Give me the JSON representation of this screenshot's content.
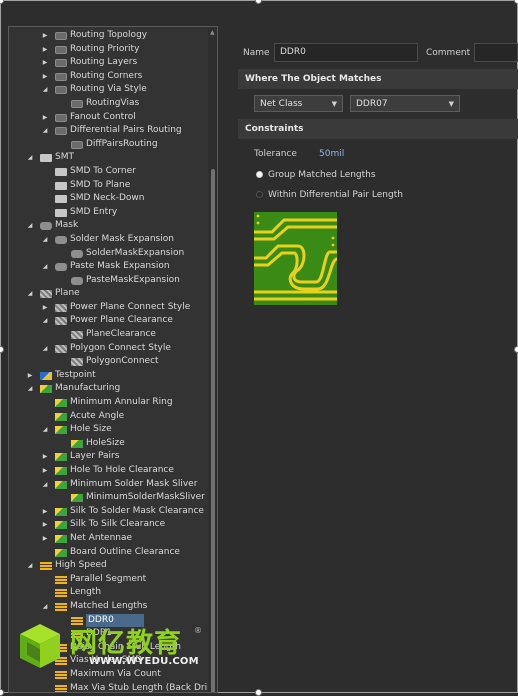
{
  "tree": [
    {
      "level": 2,
      "exp": "right",
      "icon": "rule",
      "label": "Routing Topology"
    },
    {
      "level": 2,
      "exp": "right",
      "icon": "rule",
      "label": "Routing Priority"
    },
    {
      "level": 2,
      "exp": "right",
      "icon": "rule",
      "label": "Routing Layers"
    },
    {
      "level": 2,
      "exp": "right",
      "icon": "rule",
      "label": "Routing Corners"
    },
    {
      "level": 2,
      "exp": "down",
      "icon": "rule",
      "label": "Routing Via Style"
    },
    {
      "level": 3,
      "exp": "",
      "icon": "rule",
      "label": "RoutingVias"
    },
    {
      "level": 2,
      "exp": "right",
      "icon": "rule",
      "label": "Fanout Control"
    },
    {
      "level": 2,
      "exp": "down",
      "icon": "rule",
      "label": "Differential Pairs Routing"
    },
    {
      "level": 3,
      "exp": "",
      "icon": "rule",
      "label": "DiffPairsRouting"
    },
    {
      "level": 1,
      "exp": "down",
      "icon": "smt",
      "label": "SMT"
    },
    {
      "level": 2,
      "exp": "",
      "icon": "smt",
      "label": "SMD To Corner"
    },
    {
      "level": 2,
      "exp": "",
      "icon": "smt",
      "label": "SMD To Plane"
    },
    {
      "level": 2,
      "exp": "",
      "icon": "smt",
      "label": "SMD Neck-Down"
    },
    {
      "level": 2,
      "exp": "",
      "icon": "smt",
      "label": "SMD Entry"
    },
    {
      "level": 1,
      "exp": "down",
      "icon": "mask",
      "label": "Mask"
    },
    {
      "level": 2,
      "exp": "down",
      "icon": "mask",
      "label": "Solder Mask Expansion"
    },
    {
      "level": 3,
      "exp": "",
      "icon": "mask",
      "label": "SolderMaskExpansion"
    },
    {
      "level": 2,
      "exp": "down",
      "icon": "mask",
      "label": "Paste Mask Expansion"
    },
    {
      "level": 3,
      "exp": "",
      "icon": "mask",
      "label": "PasteMaskExpansion"
    },
    {
      "level": 1,
      "exp": "down",
      "icon": "plane",
      "label": "Plane"
    },
    {
      "level": 2,
      "exp": "right",
      "icon": "plane",
      "label": "Power Plane Connect Style"
    },
    {
      "level": 2,
      "exp": "down",
      "icon": "plane",
      "label": "Power Plane Clearance"
    },
    {
      "level": 3,
      "exp": "",
      "icon": "plane",
      "label": "PlaneClearance"
    },
    {
      "level": 2,
      "exp": "down",
      "icon": "plane",
      "label": "Polygon Connect Style"
    },
    {
      "level": 3,
      "exp": "",
      "icon": "plane",
      "label": "PolygonConnect"
    },
    {
      "level": 1,
      "exp": "right",
      "icon": "test",
      "label": "Testpoint"
    },
    {
      "level": 1,
      "exp": "down",
      "icon": "mfg",
      "label": "Manufacturing"
    },
    {
      "level": 2,
      "exp": "",
      "icon": "mfg",
      "label": "Minimum Annular Ring"
    },
    {
      "level": 2,
      "exp": "",
      "icon": "mfg",
      "label": "Acute Angle"
    },
    {
      "level": 2,
      "exp": "down",
      "icon": "mfg",
      "label": "Hole Size"
    },
    {
      "level": 3,
      "exp": "",
      "icon": "mfg",
      "label": "HoleSize"
    },
    {
      "level": 2,
      "exp": "right",
      "icon": "mfg",
      "label": "Layer Pairs"
    },
    {
      "level": 2,
      "exp": "right",
      "icon": "mfg",
      "label": "Hole To Hole Clearance"
    },
    {
      "level": 2,
      "exp": "down",
      "icon": "mfg",
      "label": "Minimum Solder Mask Sliver"
    },
    {
      "level": 3,
      "exp": "",
      "icon": "mfg",
      "label": "MinimumSolderMaskSliver"
    },
    {
      "level": 2,
      "exp": "right",
      "icon": "mfg",
      "label": "Silk To Solder Mask Clearance"
    },
    {
      "level": 2,
      "exp": "right",
      "icon": "mfg",
      "label": "Silk To Silk Clearance"
    },
    {
      "level": 2,
      "exp": "right",
      "icon": "mfg",
      "label": "Net Antennae"
    },
    {
      "level": 2,
      "exp": "",
      "icon": "mfg",
      "label": "Board Outline Clearance"
    },
    {
      "level": 1,
      "exp": "down",
      "icon": "hs",
      "label": "High Speed"
    },
    {
      "level": 2,
      "exp": "",
      "icon": "hs",
      "label": "Parallel Segment"
    },
    {
      "level": 2,
      "exp": "",
      "icon": "hs",
      "label": "Length"
    },
    {
      "level": 2,
      "exp": "down",
      "icon": "hs",
      "label": "Matched Lengths"
    },
    {
      "level": 3,
      "exp": "",
      "icon": "hs",
      "label": "DDR0",
      "selected": true
    },
    {
      "level": 3,
      "exp": "",
      "icon": "hs",
      "label": "DDR1"
    },
    {
      "level": 2,
      "exp": "",
      "icon": "hs",
      "label": "Daisy Chain Stub Length"
    },
    {
      "level": 2,
      "exp": "",
      "icon": "hs",
      "label": "Vias Under SMD"
    },
    {
      "level": 2,
      "exp": "",
      "icon": "hs",
      "label": "Maximum Via Count"
    },
    {
      "level": 2,
      "exp": "",
      "icon": "hs",
      "label": "Max Via Stub Length (Back Dril"
    }
  ],
  "watermark": {
    "cn": "网亿教育",
    "url": "WWW.WYEDU.COM",
    "reg": "®"
  },
  "form": {
    "name_label": "Name",
    "name_value": "DDR0",
    "comment_label": "Comment",
    "comment_value": "",
    "where_header": "Where The Object Matches",
    "net_class": "Net Class",
    "net_value": "DDR07",
    "constraints_header": "Constraints",
    "tolerance_label": "Tolerance",
    "tolerance_value": "50mil",
    "radio_group": "Group Matched Lengths",
    "radio_diff": "Within Differential Pair Length"
  },
  "icons": {
    "expand_right": "chevron-right-icon",
    "expand_down": "chevron-down-icon"
  }
}
